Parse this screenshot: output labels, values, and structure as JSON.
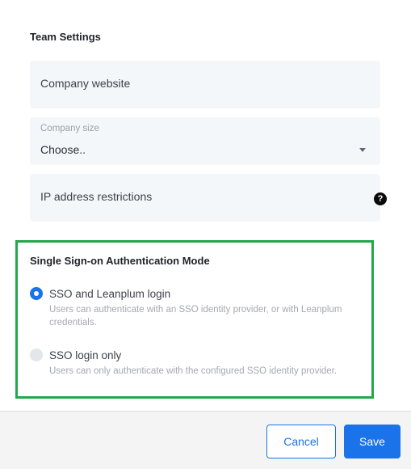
{
  "team_settings": {
    "title": "Team Settings",
    "company_website": {
      "placeholder": "Company website"
    },
    "company_size": {
      "label": "Company size",
      "value": "Choose.."
    },
    "ip_restrictions": {
      "placeholder": "IP address restrictions",
      "help_icon": "?"
    }
  },
  "sso": {
    "title": "Single Sign-on Authentication Mode",
    "options": [
      {
        "label": "SSO and Leanplum login",
        "description": "Users can authenticate with an SSO identity provider, or with Leanplum credentials.",
        "selected": true
      },
      {
        "label": "SSO login only",
        "description": "Users can only authenticate with the configured SSO identity provider.",
        "selected": false
      }
    ],
    "highlight_color": "#22a84a"
  },
  "footer": {
    "cancel_label": "Cancel",
    "save_label": "Save"
  },
  "colors": {
    "accent": "#1a73e8",
    "field_bg": "#f4f7fa"
  }
}
